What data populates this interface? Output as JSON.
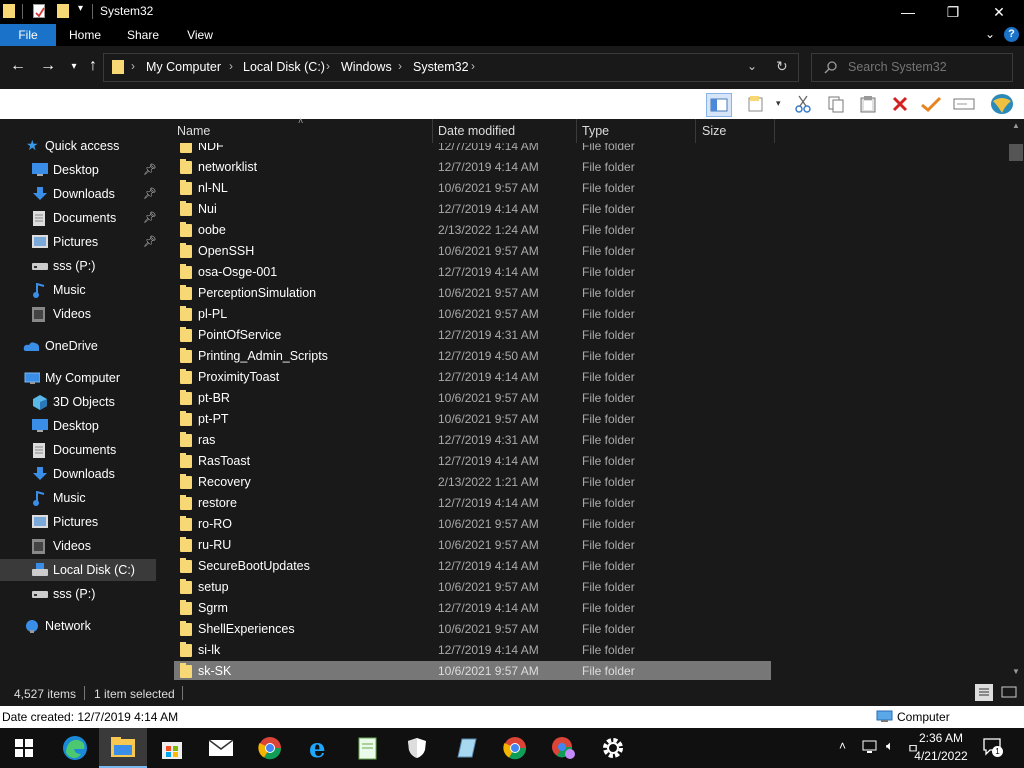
{
  "window": {
    "title": "System32",
    "minimize": "—",
    "maximize": "❐",
    "close": "✕"
  },
  "ribbon": {
    "tabs": [
      "File",
      "Home",
      "Share",
      "View"
    ]
  },
  "address": {
    "crumbs": [
      "My Computer",
      "Local Disk (C:)",
      "Windows",
      "System32"
    ],
    "search_placeholder": "Search System32"
  },
  "sidebar": {
    "quick_access": "Quick access",
    "quick_items": [
      {
        "label": "Desktop",
        "icon": "desktop-icon"
      },
      {
        "label": "Downloads",
        "icon": "downloads-icon"
      },
      {
        "label": "Documents",
        "icon": "documents-icon"
      },
      {
        "label": "Pictures",
        "icon": "pictures-icon"
      },
      {
        "label": "sss (P:)",
        "icon": "drive-icon"
      },
      {
        "label": "Music",
        "icon": "music-icon"
      },
      {
        "label": "Videos",
        "icon": "videos-icon"
      }
    ],
    "onedrive": "OneDrive",
    "computer": "My Computer",
    "computer_items": [
      {
        "label": "3D Objects",
        "icon": "3d-objects-icon"
      },
      {
        "label": "Desktop",
        "icon": "desktop-icon"
      },
      {
        "label": "Documents",
        "icon": "documents-icon"
      },
      {
        "label": "Downloads",
        "icon": "downloads-icon"
      },
      {
        "label": "Music",
        "icon": "music-icon"
      },
      {
        "label": "Pictures",
        "icon": "pictures-icon"
      },
      {
        "label": "Videos",
        "icon": "videos-icon"
      },
      {
        "label": "Local Disk (C:)",
        "icon": "local-disk-icon"
      },
      {
        "label": "sss (P:)",
        "icon": "drive-icon"
      }
    ],
    "network": "Network"
  },
  "columns": {
    "name": "Name",
    "date": "Date modified",
    "type": "Type",
    "size": "Size"
  },
  "files": [
    {
      "name": "NDF",
      "date": "12/7/2019 4:14 AM",
      "type": "File folder"
    },
    {
      "name": "networklist",
      "date": "12/7/2019 4:14 AM",
      "type": "File folder"
    },
    {
      "name": "nl-NL",
      "date": "10/6/2021 9:57 AM",
      "type": "File folder"
    },
    {
      "name": "Nui",
      "date": "12/7/2019 4:14 AM",
      "type": "File folder"
    },
    {
      "name": "oobe",
      "date": "2/13/2022 1:24 AM",
      "type": "File folder"
    },
    {
      "name": "OpenSSH",
      "date": "10/6/2021 9:57 AM",
      "type": "File folder"
    },
    {
      "name": "osa-Osge-001",
      "date": "12/7/2019 4:14 AM",
      "type": "File folder"
    },
    {
      "name": "PerceptionSimulation",
      "date": "10/6/2021 9:57 AM",
      "type": "File folder"
    },
    {
      "name": "pl-PL",
      "date": "10/6/2021 9:57 AM",
      "type": "File folder"
    },
    {
      "name": "PointOfService",
      "date": "12/7/2019 4:31 AM",
      "type": "File folder"
    },
    {
      "name": "Printing_Admin_Scripts",
      "date": "12/7/2019 4:50 AM",
      "type": "File folder"
    },
    {
      "name": "ProximityToast",
      "date": "12/7/2019 4:14 AM",
      "type": "File folder"
    },
    {
      "name": "pt-BR",
      "date": "10/6/2021 9:57 AM",
      "type": "File folder"
    },
    {
      "name": "pt-PT",
      "date": "10/6/2021 9:57 AM",
      "type": "File folder"
    },
    {
      "name": "ras",
      "date": "12/7/2019 4:31 AM",
      "type": "File folder"
    },
    {
      "name": "RasToast",
      "date": "12/7/2019 4:14 AM",
      "type": "File folder"
    },
    {
      "name": "Recovery",
      "date": "2/13/2022 1:21 AM",
      "type": "File folder"
    },
    {
      "name": "restore",
      "date": "12/7/2019 4:14 AM",
      "type": "File folder"
    },
    {
      "name": "ro-RO",
      "date": "10/6/2021 9:57 AM",
      "type": "File folder"
    },
    {
      "name": "ru-RU",
      "date": "10/6/2021 9:57 AM",
      "type": "File folder"
    },
    {
      "name": "SecureBootUpdates",
      "date": "12/7/2019 4:14 AM",
      "type": "File folder"
    },
    {
      "name": "setup",
      "date": "10/6/2021 9:57 AM",
      "type": "File folder"
    },
    {
      "name": "Sgrm",
      "date": "12/7/2019 4:14 AM",
      "type": "File folder"
    },
    {
      "name": "ShellExperiences",
      "date": "10/6/2021 9:57 AM",
      "type": "File folder"
    },
    {
      "name": "si-lk",
      "date": "12/7/2019 4:14 AM",
      "type": "File folder"
    },
    {
      "name": "sk-SK",
      "date": "10/6/2021 9:57 AM",
      "type": "File folder",
      "selected": true
    }
  ],
  "status": {
    "count": "4,527 items",
    "selected": "1 item selected"
  },
  "details": {
    "created": "Date created: 12/7/2019 4:14 AM",
    "location": "Computer"
  },
  "clock": {
    "time": "2:36 AM",
    "date": "4/21/2022"
  },
  "notifications_count": "1",
  "colors": {
    "accent": "#1a73c8",
    "folder": "#f8d775",
    "background": "#191919"
  }
}
